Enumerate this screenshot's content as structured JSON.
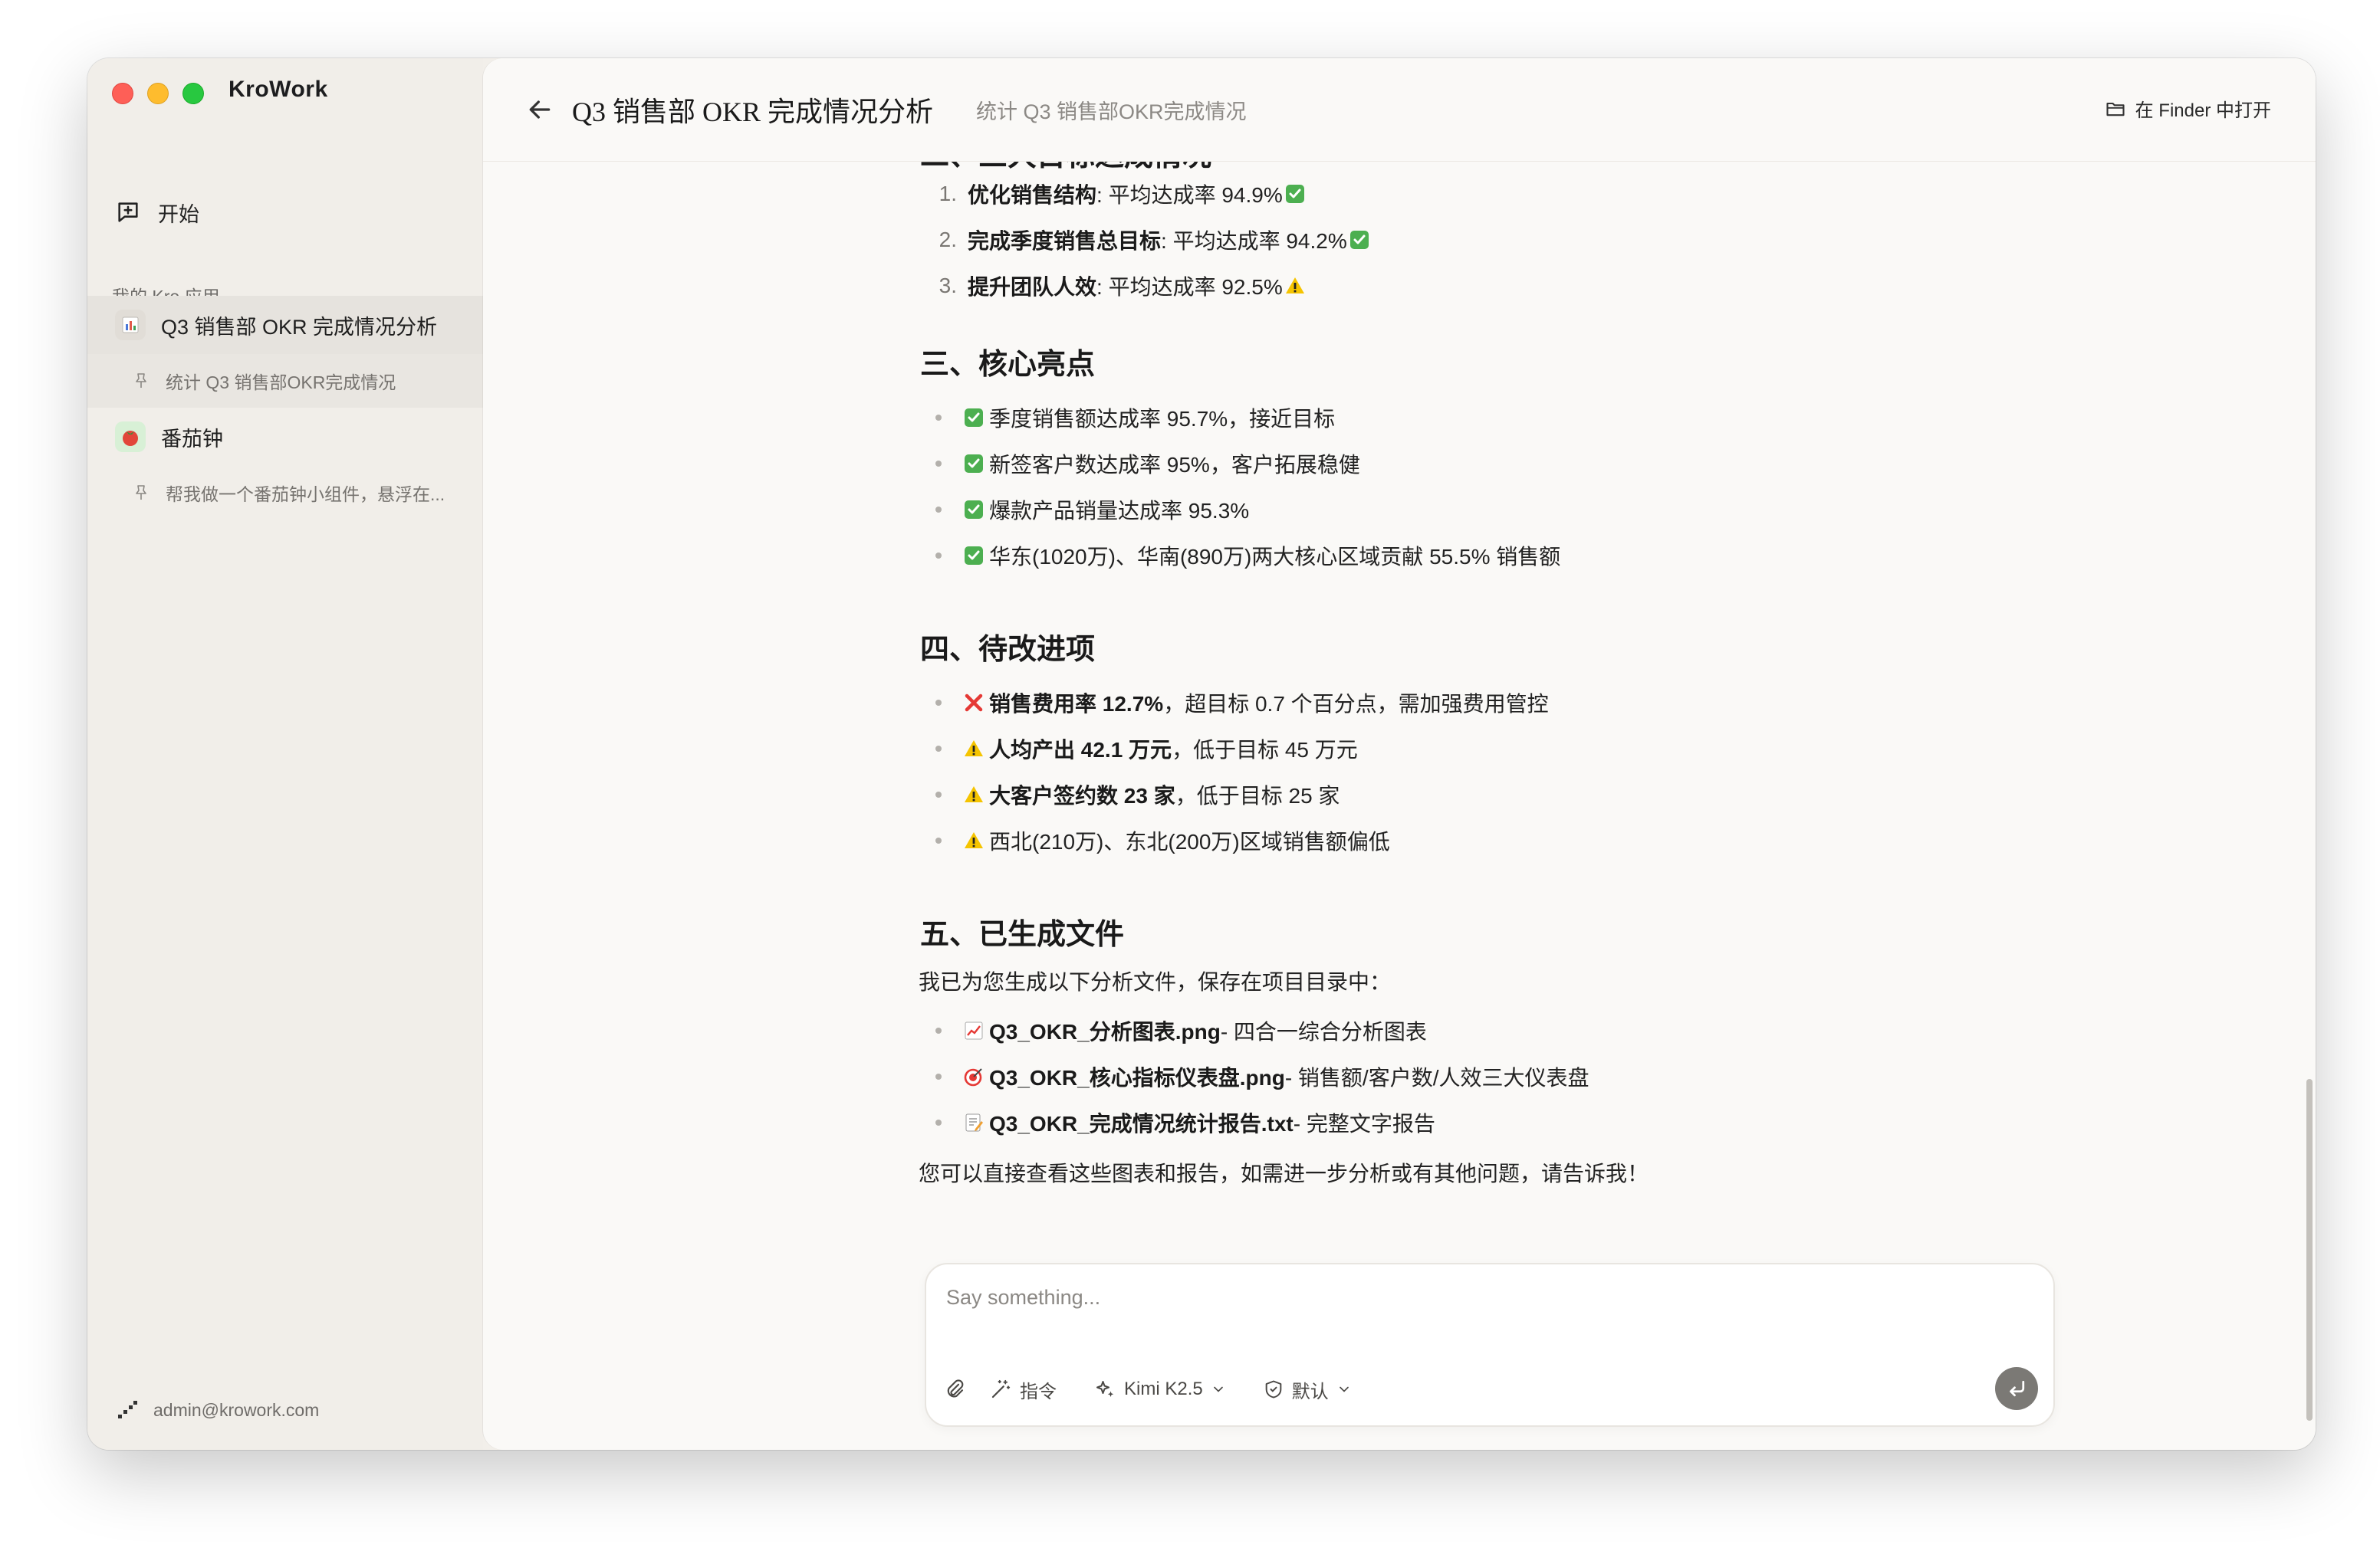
{
  "app": {
    "name": "KroWork"
  },
  "sidebar": {
    "start_label": "开始",
    "section_label": "我的 Kro 应用",
    "apps": [
      {
        "title": "Q3 销售部 OKR 完成情况分析",
        "icon": "bar-chart-icon",
        "session": "统计 Q3 销售部OKR完成情况"
      },
      {
        "title": "番茄钟",
        "icon": "tomato-icon",
        "session": "帮我做一个番茄钟小组件，悬浮在..."
      }
    ],
    "user": "admin@krowork.com"
  },
  "header": {
    "title": "Q3 销售部 OKR 完成情况分析",
    "subtitle": "统计 Q3 销售部OKR完成情况",
    "finder_label": "在 Finder 中打开"
  },
  "doc": {
    "section2": {
      "title": "二、三大目标达成情况",
      "items": [
        {
          "num": "1.",
          "bold": "优化销售结构",
          "text": ": 平均达成率 94.9%",
          "status": "check"
        },
        {
          "num": "2.",
          "bold": "完成季度销售总目标",
          "text": ": 平均达成率 94.2%",
          "status": "check"
        },
        {
          "num": "3.",
          "bold": "提升团队人效",
          "text": ": 平均达成率 92.5%",
          "status": "warn"
        }
      ]
    },
    "section3": {
      "title": "三、核心亮点",
      "items": [
        "季度销售额达成率 95.7%，接近目标",
        "新签客户数达成率 95%，客户拓展稳健",
        "爆款产品销量达成率 95.3%",
        "华东(1020万)、华南(890万)两大核心区域贡献 55.5% 销售额"
      ]
    },
    "section4": {
      "title": "四、待改进项",
      "items": [
        {
          "status": "cross",
          "bold": "销售费用率 12.7%",
          "text": "，超目标 0.7 个百分点，需加强费用管控"
        },
        {
          "status": "warn",
          "bold": "人均产出 42.1 万元",
          "text": "，低于目标 45 万元"
        },
        {
          "status": "warn",
          "bold": "大客户签约数 23 家",
          "text": "，低于目标 25 家"
        },
        {
          "status": "warn",
          "bold": "",
          "text": "西北(210万)、东北(200万)区域销售额偏低"
        }
      ]
    },
    "section5": {
      "title": "五、已生成文件",
      "intro": "我已为您生成以下分析文件，保存在项目目录中：",
      "files": [
        {
          "icon": "chart-up-icon",
          "name": "Q3_OKR_分析图表.png",
          "desc": " - 四合一综合分析图表"
        },
        {
          "icon": "target-icon",
          "name": "Q3_OKR_核心指标仪表盘.png",
          "desc": " - 销售额/客户数/人效三大仪表盘"
        },
        {
          "icon": "memo-icon",
          "name": "Q3_OKR_完成情况统计报告.txt",
          "desc": " - 完整文字报告"
        }
      ],
      "outro": "您可以直接查看这些图表和报告，如需进一步分析或有其他问题，请告诉我！"
    }
  },
  "composer": {
    "placeholder": "Say something...",
    "command_label": "指令",
    "model_label": "Kimi K2.5",
    "mode_label": "默认"
  },
  "colors": {
    "check_green": "#4caf50",
    "warn_yellow": "#f5c400",
    "cross_red": "#e53935"
  }
}
